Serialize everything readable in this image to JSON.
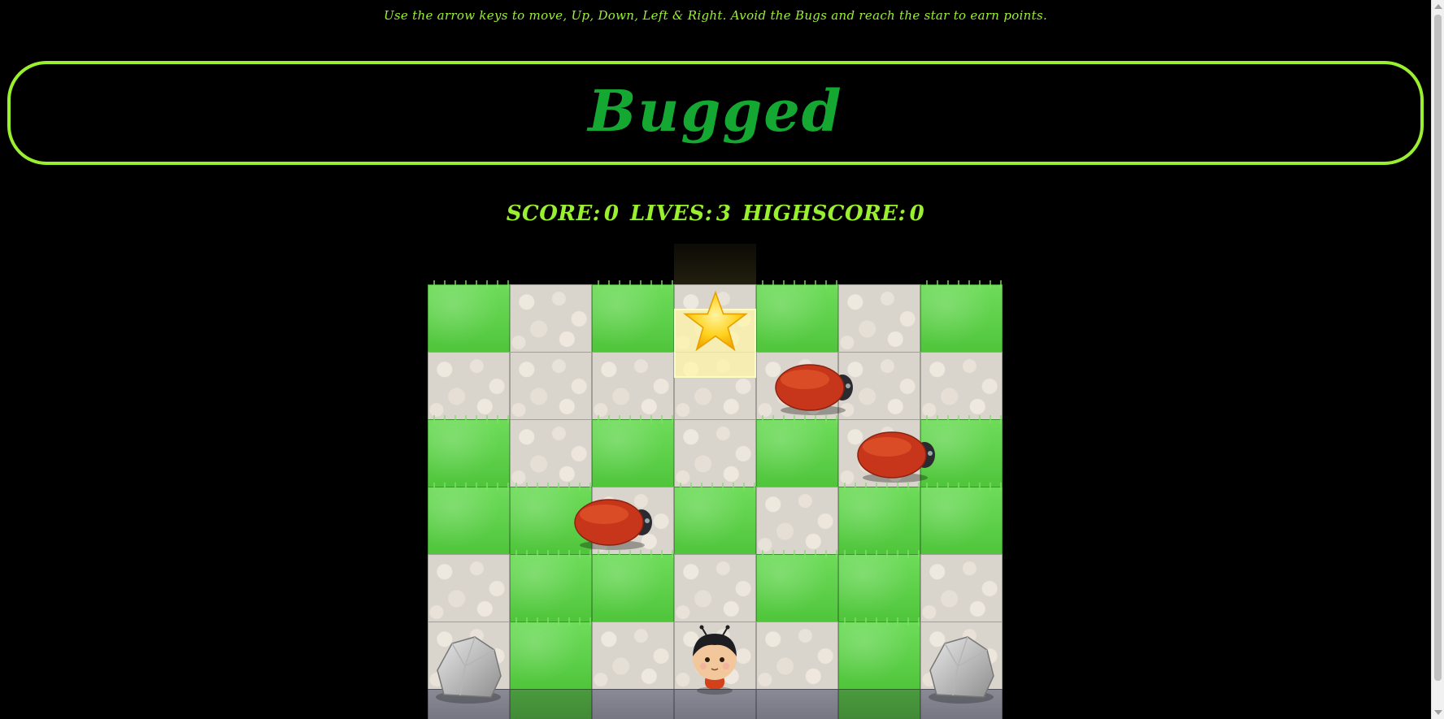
{
  "instructions": "Use the arrow keys to move, Up, Down, Left & Right. Avoid the Bugs and reach the star to earn points.",
  "title": "Bugged",
  "score": {
    "label": "SCORE:",
    "value": "0"
  },
  "lives": {
    "label": "LIVES:",
    "value": "3"
  },
  "highscore": {
    "label": "HIGHSCORE:",
    "value": "0"
  },
  "colors": {
    "accent": "#9af02e",
    "title": "#14a832",
    "background": "#000000"
  },
  "board": {
    "rows": [
      [
        "grass",
        "stone",
        "grass",
        "star",
        "grass",
        "stone",
        "grass"
      ],
      [
        "stone",
        "stone",
        "stone",
        "stone",
        "stone",
        "stone",
        "stone"
      ],
      [
        "grass",
        "stone",
        "grass",
        "stone",
        "grass",
        "stone",
        "grass"
      ],
      [
        "grass",
        "grass",
        "stone",
        "grass",
        "stone",
        "grass",
        "grass"
      ],
      [
        "stone",
        "grass",
        "grass",
        "stone",
        "grass",
        "grass",
        "stone"
      ],
      [
        "stone",
        "grass",
        "stone",
        "stone",
        "stone",
        "grass",
        "stone"
      ]
    ],
    "bugs": [
      {
        "row": 1,
        "col": 4.2
      },
      {
        "row": 2,
        "col": 5.2
      },
      {
        "row": 3,
        "col": 1.75
      }
    ],
    "rocks": [
      {
        "row": 5,
        "col": 0
      },
      {
        "row": 5,
        "col": 6
      }
    ],
    "player": {
      "row": 5,
      "col": 3
    }
  }
}
